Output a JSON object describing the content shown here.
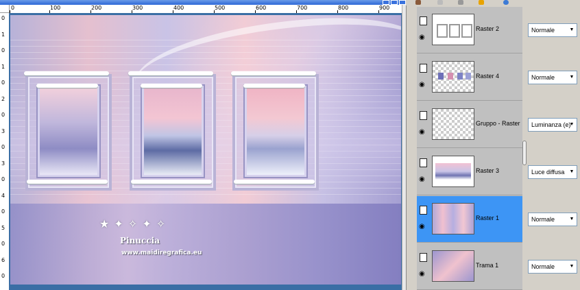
{
  "canvas": {
    "ruler_h_labels": [
      "0",
      "100",
      "200",
      "300",
      "400",
      "500",
      "600",
      "700",
      "800",
      "900"
    ],
    "ruler_v_labels": [
      "0",
      "1",
      "0",
      "1",
      "0",
      "2",
      "0",
      "3",
      "0",
      "3",
      "0",
      "4",
      "0",
      "5",
      "0",
      "6",
      "0"
    ],
    "watermark_name": "Pinuccia",
    "watermark_url": "www.maidiregrafica.eu"
  },
  "layers": [
    {
      "name": "Raster 2",
      "mode": "Normale",
      "selected": false,
      "thumb": "frames-outline"
    },
    {
      "name": "Raster 4",
      "mode": "Normale",
      "selected": false,
      "thumb": "small-frames"
    },
    {
      "name": "Gruppo - Raster",
      "mode": "Luminanza (e)",
      "selected": false,
      "thumb": "transparent"
    },
    {
      "name": "Raster 3",
      "mode": "Luce diffusa",
      "selected": false,
      "thumb": "winter-scene"
    },
    {
      "name": "Raster 1",
      "mode": "Normale",
      "selected": true,
      "thumb": "gradient-pattern"
    },
    {
      "name": "Trama 1",
      "mode": "Normale",
      "selected": false,
      "thumb": "pattern"
    }
  ],
  "colors": {
    "selected_row": "#3d95f5",
    "panel_bg": "#d4d0c8",
    "canvas_backdrop": "#3a6ea5"
  },
  "icons": [
    "document-icon",
    "eye-icon",
    "chevron-down-icon"
  ]
}
